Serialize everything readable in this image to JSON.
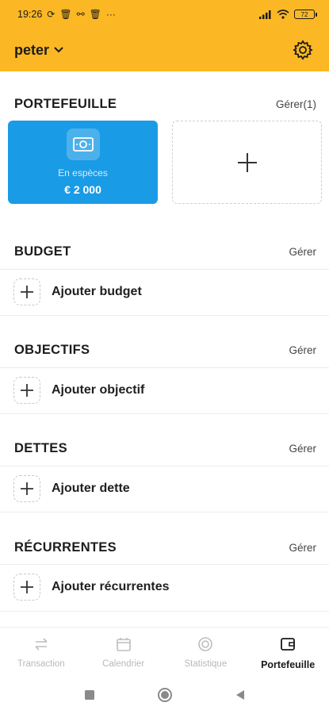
{
  "status_bar": {
    "time": "19:26",
    "battery": "72"
  },
  "header": {
    "user_name": "peter"
  },
  "wallet_section": {
    "title": "PORTEFEUILLE",
    "manage_label": "Gérer(1)",
    "wallet": {
      "name": "En espèces",
      "amount": "€ 2 000",
      "color": "#1a9be6"
    }
  },
  "budget_section": {
    "title": "BUDGET",
    "manage_label": "Gérer",
    "add_label": "Ajouter budget"
  },
  "goals_section": {
    "title": "OBJECTIFS",
    "manage_label": "Gérer",
    "add_label": "Ajouter objectif"
  },
  "debts_section": {
    "title": "DETTES",
    "manage_label": "Gérer",
    "add_label": "Ajouter dette"
  },
  "recurring_section": {
    "title": "RÉCURRENTES",
    "manage_label": "Gérer",
    "add_label": "Ajouter récurrentes"
  },
  "bottom_nav": {
    "items": [
      {
        "label": "Transaction",
        "icon": "transfer-icon"
      },
      {
        "label": "Calendrier",
        "icon": "calendar-icon"
      },
      {
        "label": "Statistique",
        "icon": "chart-icon"
      },
      {
        "label": "Portefeuille",
        "icon": "wallet-icon",
        "active": true
      }
    ]
  },
  "theme": {
    "header_color": "#fbb824",
    "accent": "#1a9be6"
  }
}
